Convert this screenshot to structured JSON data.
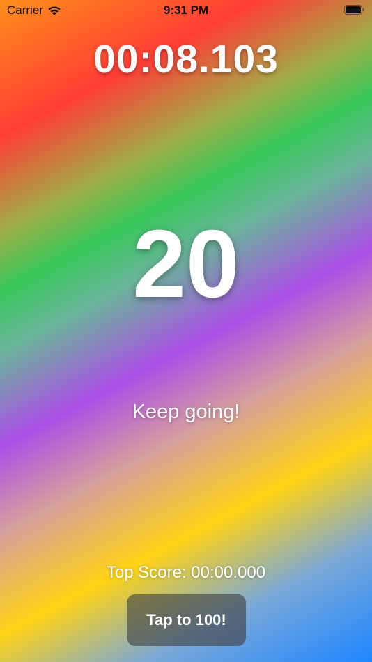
{
  "status_bar": {
    "carrier": "Carrier",
    "time": "9:31 PM",
    "icons": [
      "wifi-icon",
      "battery-icon"
    ]
  },
  "game": {
    "timer": "00:08.103",
    "count": "20",
    "message": "Keep going!",
    "top_score": "Top Score: 00:00.000",
    "button_label": "Tap to 100!"
  },
  "colors": {
    "text": "#ffffff",
    "button_bg": "#3c3c3c",
    "gradient": [
      "#ff8f1a",
      "#ff3d36",
      "#38c85a",
      "#ab4fe6",
      "#ffd315",
      "#1e86ff"
    ]
  }
}
